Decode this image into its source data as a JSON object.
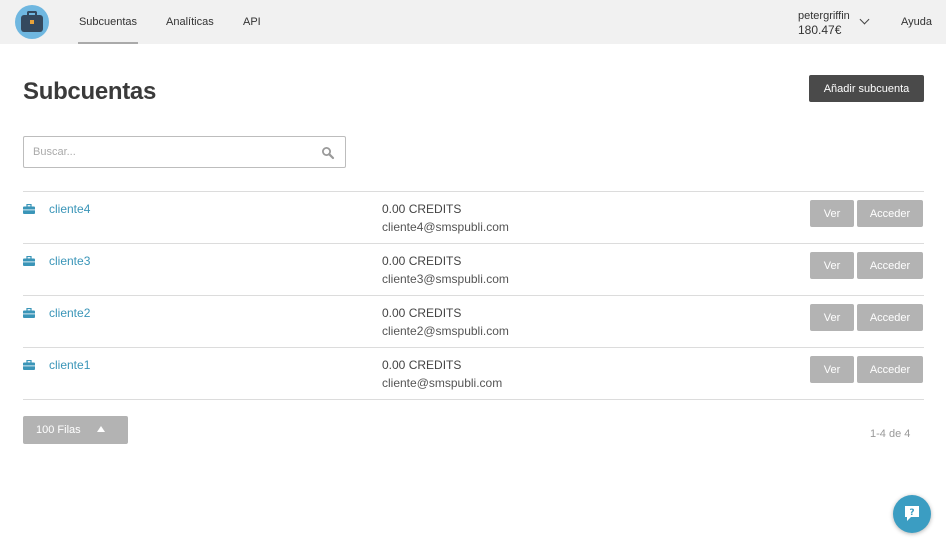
{
  "header": {
    "tabs": [
      {
        "label": "Subcuentas",
        "active": true
      },
      {
        "label": "Analíticas",
        "active": false
      },
      {
        "label": "API",
        "active": false
      }
    ],
    "user": {
      "name": "petergriffin",
      "balance": "180.47€"
    },
    "help_label": "Ayuda",
    "logo_icon": "briefcase-icon"
  },
  "main": {
    "title": "Subcuentas",
    "add_button_label": "Añadir subcuenta",
    "search": {
      "placeholder": "Buscar...",
      "value": "",
      "icon": "search-icon"
    }
  },
  "accounts": [
    {
      "name": "cliente4",
      "credits": "0.00 CREDITS",
      "email": "cliente4@smspubli.com",
      "view_label": "Ver",
      "access_label": "Acceder"
    },
    {
      "name": "cliente3",
      "credits": "0.00 CREDITS",
      "email": "cliente3@smspubli.com",
      "view_label": "Ver",
      "access_label": "Acceder"
    },
    {
      "name": "cliente2",
      "credits": "0.00 CREDITS",
      "email": "cliente2@smspubli.com",
      "view_label": "Ver",
      "access_label": "Acceder"
    },
    {
      "name": "cliente1",
      "credits": "0.00 CREDITS",
      "email": "cliente@smspubli.com",
      "view_label": "Ver",
      "access_label": "Acceder"
    }
  ],
  "footer": {
    "rows_label": "100 Filas",
    "pagination": "1-4 de 4"
  },
  "colors": {
    "accent": "#3b9dc2",
    "link": "#3a95b8",
    "button_gray": "#b3b3b3",
    "primary_button": "#4a4a4a"
  }
}
